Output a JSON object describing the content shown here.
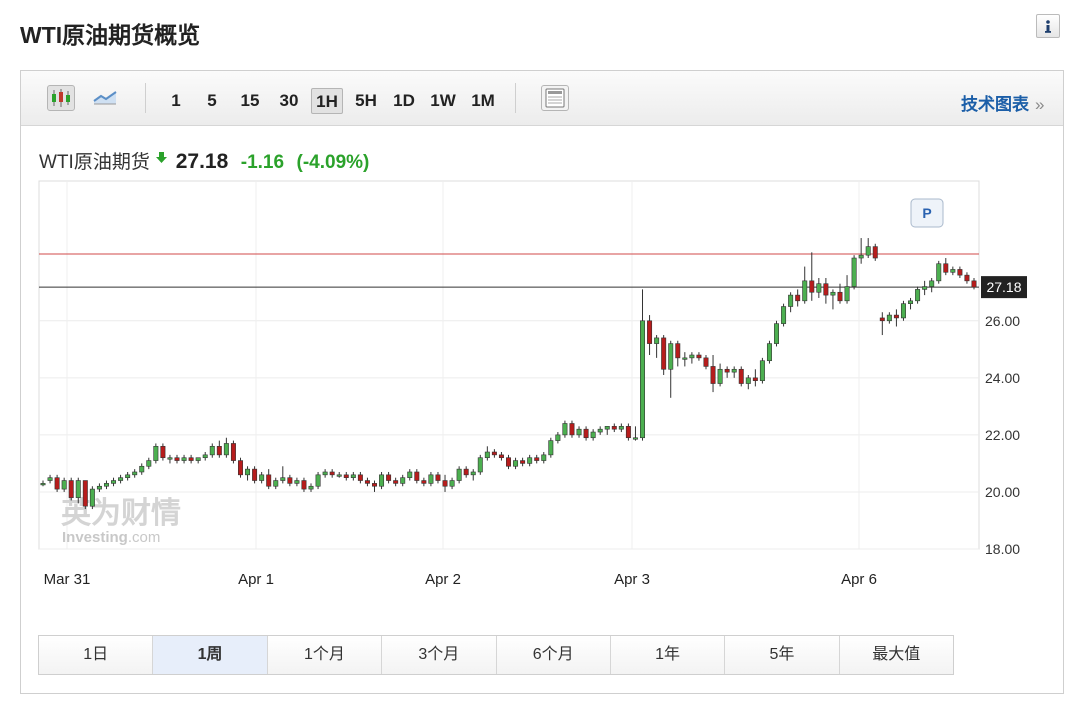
{
  "page": {
    "title": "WTI原油期货概览"
  },
  "toolbar": {
    "timeframes": [
      "1",
      "5",
      "15",
      "30",
      "1H",
      "5H",
      "1D",
      "1W",
      "1M"
    ],
    "active_timeframe": "1H",
    "tech_link": "技术图表",
    "tech_link_arrow": "»"
  },
  "quote": {
    "name": "WTI原油期货",
    "price": "27.18",
    "change": "-1.16",
    "change_pct": "(-4.09%)"
  },
  "colors": {
    "up": "#2ba22b",
    "down": "#c0392b",
    "up_candle": "#4caf50",
    "down_candle": "#b71c1c"
  },
  "ranges": {
    "items": [
      "1日",
      "1周",
      "1个月",
      "3个月",
      "6个月",
      "1年",
      "5年",
      "最大值"
    ],
    "active": "1周"
  },
  "watermark": {
    "brand": "英为财情",
    "sub": "Investing",
    "domain": ".com"
  },
  "marker_label": "P",
  "chart_data": {
    "type": "candlestick",
    "y_ticks": [
      "26.00",
      "24.00",
      "22.00",
      "20.00",
      "18.00"
    ],
    "ylim": [
      18,
      30.9
    ],
    "x_labels": [
      "Mar 31",
      "Apr 1",
      "Apr 2",
      "Apr 3",
      "Apr 6"
    ],
    "last_price_label": "27.18",
    "last_price": 27.18,
    "previous_close": 28.34,
    "grid": true,
    "candles": [
      [
        20.3,
        20.4,
        20.2,
        20.3
      ],
      [
        20.4,
        20.6,
        20.3,
        20.5
      ],
      [
        20.5,
        20.6,
        20.0,
        20.1
      ],
      [
        20.1,
        20.5,
        20.0,
        20.4
      ],
      [
        20.4,
        20.5,
        19.7,
        19.8
      ],
      [
        19.8,
        20.5,
        19.6,
        20.4
      ],
      [
        20.4,
        20.4,
        19.4,
        19.5
      ],
      [
        19.5,
        20.2,
        19.4,
        20.1
      ],
      [
        20.1,
        20.3,
        20.0,
        20.2
      ],
      [
        20.2,
        20.4,
        20.1,
        20.3
      ],
      [
        20.3,
        20.5,
        20.2,
        20.4
      ],
      [
        20.4,
        20.6,
        20.3,
        20.5
      ],
      [
        20.5,
        20.7,
        20.4,
        20.6
      ],
      [
        20.6,
        20.8,
        20.5,
        20.7
      ],
      [
        20.7,
        21.0,
        20.6,
        20.9
      ],
      [
        20.9,
        21.2,
        20.8,
        21.1
      ],
      [
        21.1,
        21.7,
        21.0,
        21.6
      ],
      [
        21.6,
        21.7,
        21.1,
        21.2
      ],
      [
        21.2,
        21.3,
        21.0,
        21.2
      ],
      [
        21.2,
        21.3,
        21.0,
        21.1
      ],
      [
        21.1,
        21.3,
        21.0,
        21.2
      ],
      [
        21.2,
        21.3,
        21.0,
        21.1
      ],
      [
        21.1,
        21.2,
        21.0,
        21.2
      ],
      [
        21.2,
        21.4,
        21.1,
        21.3
      ],
      [
        21.3,
        21.7,
        21.2,
        21.6
      ],
      [
        21.6,
        21.8,
        21.2,
        21.3
      ],
      [
        21.3,
        21.9,
        21.2,
        21.7
      ],
      [
        21.7,
        21.8,
        21.0,
        21.1
      ],
      [
        21.1,
        21.2,
        20.5,
        20.6
      ],
      [
        20.6,
        20.9,
        20.4,
        20.8
      ],
      [
        20.8,
        20.9,
        20.3,
        20.4
      ],
      [
        20.4,
        20.7,
        20.3,
        20.6
      ],
      [
        20.6,
        20.8,
        20.1,
        20.2
      ],
      [
        20.2,
        20.5,
        20.1,
        20.4
      ],
      [
        20.4,
        20.9,
        20.3,
        20.5
      ],
      [
        20.5,
        20.6,
        20.2,
        20.3
      ],
      [
        20.3,
        20.5,
        20.2,
        20.4
      ],
      [
        20.4,
        20.5,
        20.0,
        20.1
      ],
      [
        20.1,
        20.3,
        20.0,
        20.2
      ],
      [
        20.2,
        20.7,
        20.1,
        20.6
      ],
      [
        20.6,
        20.8,
        20.5,
        20.7
      ],
      [
        20.7,
        20.8,
        20.5,
        20.6
      ],
      [
        20.6,
        20.7,
        20.5,
        20.6
      ],
      [
        20.6,
        20.7,
        20.4,
        20.5
      ],
      [
        20.5,
        20.7,
        20.4,
        20.6
      ],
      [
        20.6,
        20.7,
        20.3,
        20.4
      ],
      [
        20.4,
        20.5,
        20.2,
        20.3
      ],
      [
        20.3,
        20.4,
        20.0,
        20.2
      ],
      [
        20.2,
        20.7,
        20.1,
        20.6
      ],
      [
        20.6,
        20.7,
        20.3,
        20.4
      ],
      [
        20.4,
        20.5,
        20.2,
        20.3
      ],
      [
        20.3,
        20.6,
        20.2,
        20.5
      ],
      [
        20.5,
        20.8,
        20.4,
        20.7
      ],
      [
        20.7,
        20.8,
        20.3,
        20.4
      ],
      [
        20.4,
        20.5,
        20.2,
        20.3
      ],
      [
        20.3,
        20.7,
        20.2,
        20.6
      ],
      [
        20.6,
        20.7,
        20.3,
        20.4
      ],
      [
        20.4,
        20.6,
        20.0,
        20.2
      ],
      [
        20.2,
        20.5,
        20.1,
        20.4
      ],
      [
        20.4,
        20.9,
        20.3,
        20.8
      ],
      [
        20.8,
        20.9,
        20.5,
        20.6
      ],
      [
        20.6,
        20.8,
        20.4,
        20.7
      ],
      [
        20.7,
        21.3,
        20.6,
        21.2
      ],
      [
        21.2,
        21.6,
        21.1,
        21.4
      ],
      [
        21.4,
        21.5,
        21.2,
        21.3
      ],
      [
        21.3,
        21.4,
        21.1,
        21.2
      ],
      [
        21.2,
        21.3,
        20.8,
        20.9
      ],
      [
        20.9,
        21.2,
        20.8,
        21.1
      ],
      [
        21.1,
        21.2,
        20.9,
        21.0
      ],
      [
        21.0,
        21.3,
        20.9,
        21.2
      ],
      [
        21.2,
        21.3,
        21.0,
        21.1
      ],
      [
        21.1,
        21.4,
        21.0,
        21.3
      ],
      [
        21.3,
        21.9,
        21.2,
        21.8
      ],
      [
        21.8,
        22.1,
        21.7,
        22.0
      ],
      [
        22.0,
        22.5,
        21.9,
        22.4
      ],
      [
        22.4,
        22.5,
        21.9,
        22.0
      ],
      [
        22.0,
        22.3,
        21.9,
        22.2
      ],
      [
        22.2,
        22.3,
        21.8,
        21.9
      ],
      [
        21.9,
        22.2,
        21.8,
        22.1
      ],
      [
        22.1,
        22.3,
        22.0,
        22.2
      ],
      [
        22.2,
        22.3,
        22.0,
        22.3
      ],
      [
        22.3,
        22.4,
        22.1,
        22.2
      ],
      [
        22.2,
        22.4,
        22.1,
        22.3
      ],
      [
        22.3,
        22.4,
        21.8,
        21.9
      ],
      [
        21.9,
        22.3,
        21.8,
        21.9
      ],
      [
        21.9,
        27.1,
        21.8,
        26.0
      ],
      [
        26.0,
        26.2,
        24.8,
        25.2
      ],
      [
        25.2,
        25.5,
        24.7,
        25.4
      ],
      [
        25.4,
        25.5,
        24.1,
        24.3
      ],
      [
        24.3,
        25.3,
        23.3,
        25.2
      ],
      [
        25.2,
        25.3,
        24.4,
        24.7
      ],
      [
        24.7,
        24.9,
        24.4,
        24.7
      ],
      [
        24.7,
        24.9,
        24.5,
        24.8
      ],
      [
        24.8,
        24.9,
        24.6,
        24.7
      ],
      [
        24.7,
        24.8,
        24.3,
        24.4
      ],
      [
        24.4,
        24.8,
        23.5,
        23.8
      ],
      [
        23.8,
        24.5,
        23.7,
        24.3
      ],
      [
        24.3,
        24.4,
        24.0,
        24.2
      ],
      [
        24.2,
        24.4,
        24.0,
        24.3
      ],
      [
        24.3,
        24.4,
        23.7,
        23.8
      ],
      [
        23.8,
        24.1,
        23.6,
        24.0
      ],
      [
        24.0,
        24.3,
        23.7,
        23.9
      ],
      [
        23.9,
        24.7,
        23.8,
        24.6
      ],
      [
        24.6,
        25.3,
        24.5,
        25.2
      ],
      [
        25.2,
        26.0,
        25.1,
        25.9
      ],
      [
        25.9,
        26.6,
        25.8,
        26.5
      ],
      [
        26.5,
        27.0,
        26.3,
        26.9
      ],
      [
        26.9,
        27.1,
        26.5,
        26.7
      ],
      [
        26.7,
        27.9,
        26.6,
        27.4
      ],
      [
        27.4,
        28.4,
        26.7,
        27.0
      ],
      [
        27.0,
        27.5,
        26.8,
        27.3
      ],
      [
        27.3,
        27.5,
        26.6,
        26.9
      ],
      [
        26.9,
        27.1,
        26.4,
        27.0
      ],
      [
        27.0,
        27.3,
        26.6,
        26.7
      ],
      [
        26.7,
        27.6,
        26.6,
        27.2
      ],
      [
        27.2,
        28.3,
        27.1,
        28.2
      ],
      [
        28.2,
        28.9,
        28.0,
        28.3
      ],
      [
        28.3,
        28.9,
        28.2,
        28.6
      ],
      [
        28.6,
        28.7,
        28.1,
        28.2
      ],
      [
        26.1,
        26.3,
        25.5,
        26.0
      ],
      [
        26.0,
        26.3,
        25.9,
        26.2
      ],
      [
        26.2,
        26.4,
        25.8,
        26.1
      ],
      [
        26.1,
        26.7,
        26.0,
        26.6
      ],
      [
        26.6,
        26.8,
        26.4,
        26.7
      ],
      [
        26.7,
        27.2,
        26.6,
        27.1
      ],
      [
        27.1,
        27.4,
        26.9,
        27.2
      ],
      [
        27.2,
        27.5,
        27.0,
        27.4
      ],
      [
        27.4,
        28.1,
        27.3,
        28.0
      ],
      [
        28.0,
        28.2,
        27.6,
        27.7
      ],
      [
        27.7,
        27.9,
        27.6,
        27.8
      ],
      [
        27.8,
        27.9,
        27.5,
        27.6
      ],
      [
        27.6,
        27.7,
        27.3,
        27.4
      ],
      [
        27.4,
        27.5,
        27.1,
        27.18
      ]
    ]
  }
}
